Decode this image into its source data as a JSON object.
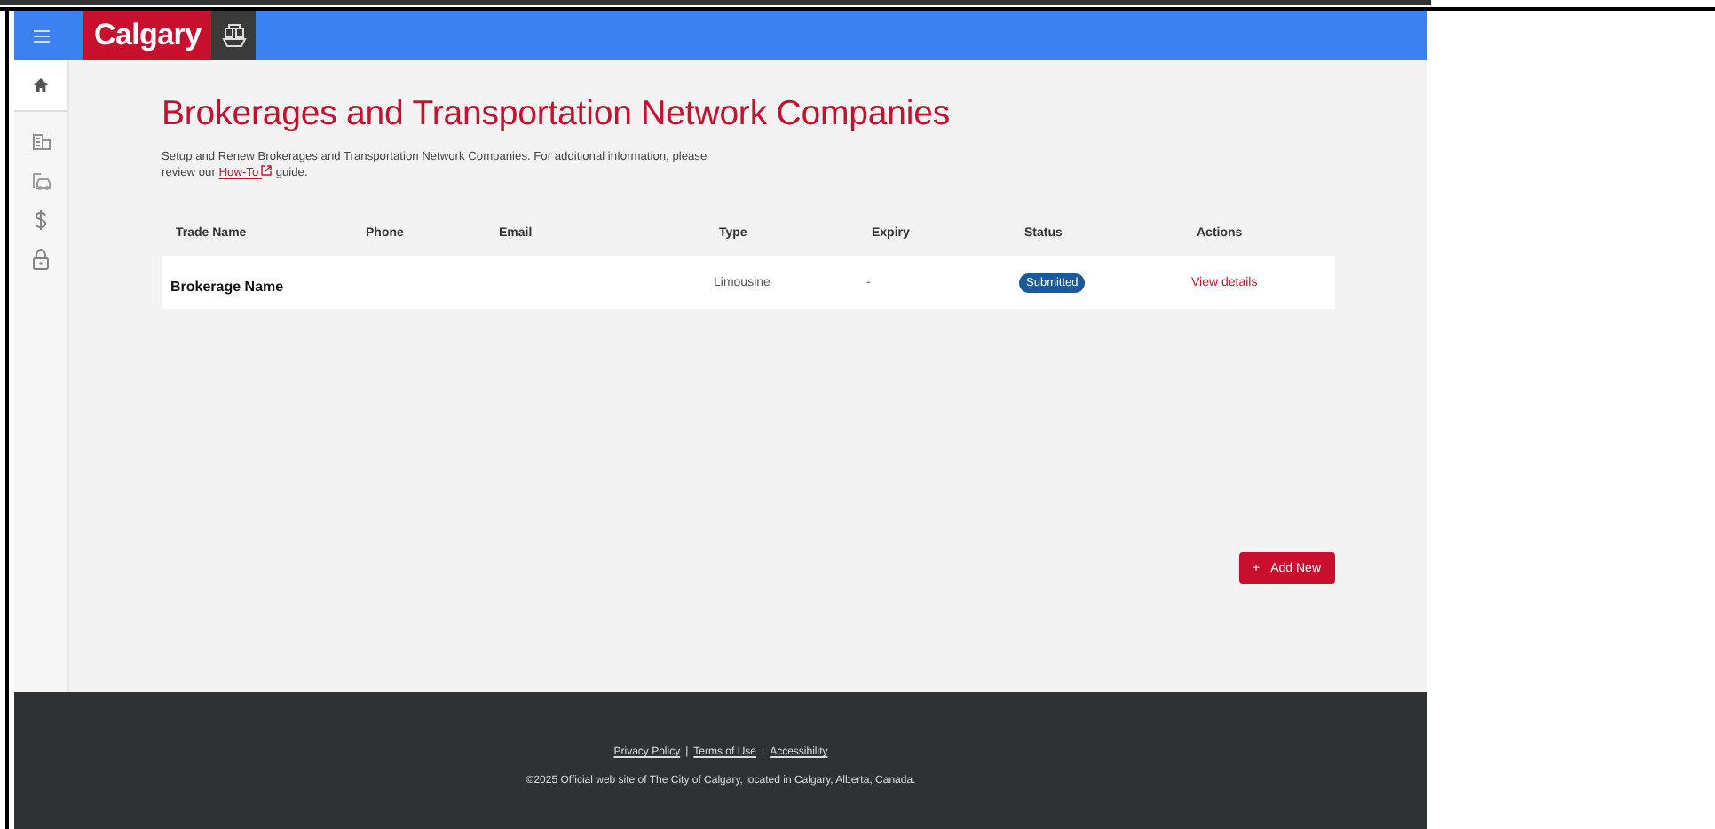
{
  "header": {
    "logo_text": "Calgary"
  },
  "sidebar": {
    "items": [
      {
        "selected": true
      },
      {
        "selected": false
      },
      {
        "selected": false
      },
      {
        "selected": false
      },
      {
        "selected": false
      }
    ]
  },
  "page": {
    "title": "Brokerages and Transportation Network Companies",
    "description_before": "Setup and Renew Brokerages and Transportation Network Companies. For additional information, please review our",
    "link": "How-To",
    "description_after": "guide."
  },
  "table": {
    "columns": [
      "Trade Name",
      "Phone",
      "Email",
      "Type",
      "Expiry",
      "Status",
      "Actions"
    ],
    "rows": [
      {
        "trade_name": "Brokerage Name",
        "phone": "",
        "email": "",
        "type": "Limousine",
        "expiry": "-",
        "status": "Submitted",
        "action": "View details"
      }
    ]
  },
  "add_button": {
    "icon": "+",
    "label": "Add New"
  },
  "footer": {
    "links": [
      "Privacy Policy",
      "Terms of Use",
      "Accessibility"
    ],
    "separator": "|",
    "copyright": "©2025 Official web site of The City of Calgary, located in Calgary, Alberta, Canada."
  }
}
